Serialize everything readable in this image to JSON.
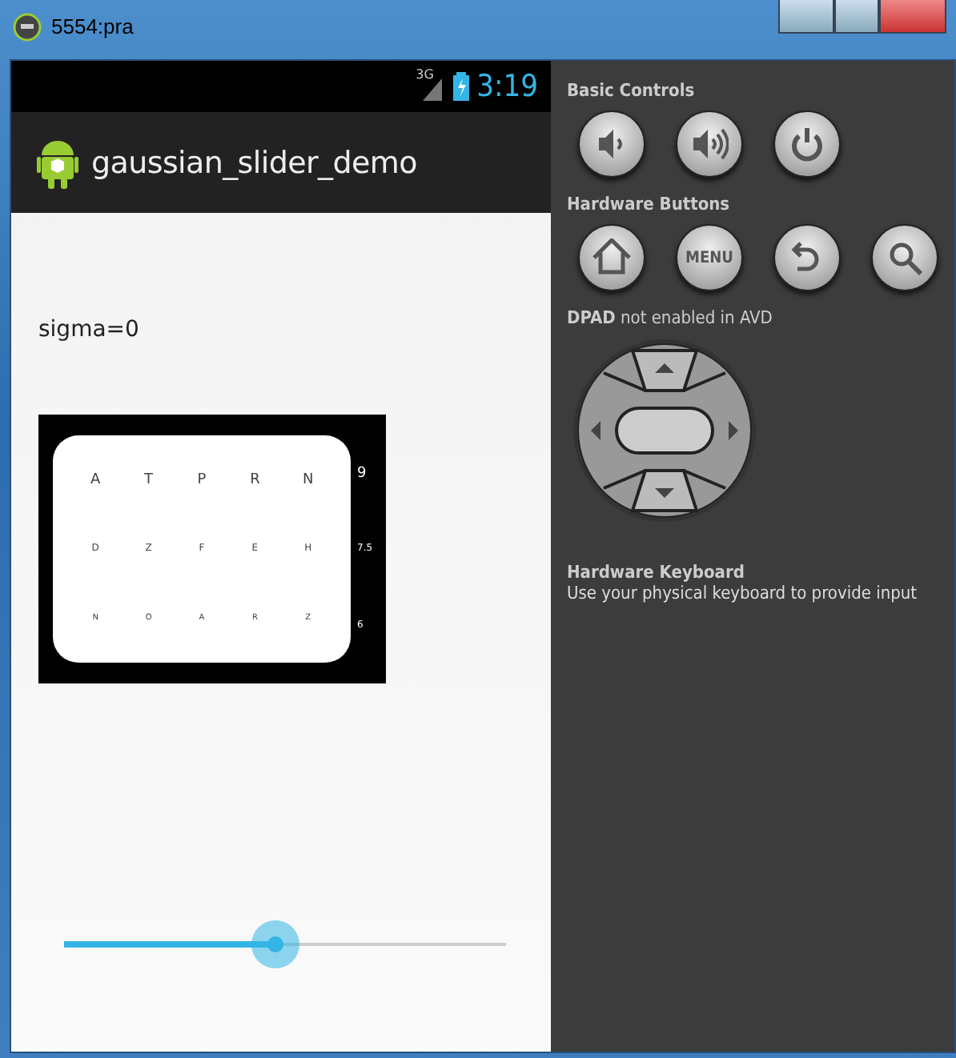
{
  "window": {
    "title": "5554:pra"
  },
  "status_bar": {
    "network": "3G",
    "time": "3:19"
  },
  "action_bar": {
    "title": "gaussian_slider_demo"
  },
  "content": {
    "sigma_label": "sigma=0",
    "eye_chart": {
      "rows": [
        {
          "letters": [
            "A",
            "T",
            "P",
            "R",
            "N"
          ],
          "size": "9"
        },
        {
          "letters": [
            "D",
            "Z",
            "F",
            "E",
            "H"
          ],
          "size": "7.5"
        },
        {
          "letters": [
            "N",
            "O",
            "A",
            "R",
            "Z"
          ],
          "size": "6"
        }
      ]
    },
    "slider": {
      "level": 0.48
    }
  },
  "controls": {
    "sections": [
      {
        "kind": "buttons",
        "title": "Basic Controls",
        "buttons": [
          {
            "kind": "volume-down"
          },
          {
            "kind": "volume-up"
          },
          {
            "kind": "power"
          }
        ]
      },
      {
        "kind": "buttons",
        "title": "Hardware Buttons",
        "buttons": [
          {
            "kind": "home"
          },
          {
            "kind": "text",
            "label": "MENU"
          },
          {
            "kind": "back"
          },
          {
            "kind": "search"
          }
        ]
      },
      {
        "kind": "dpad",
        "title": "**DPAD** not enabled in AVD"
      },
      {
        "kind": "text",
        "title": "Hardware Keyboard",
        "text": "Use your physical keyboard to provide input"
      }
    ]
  }
}
